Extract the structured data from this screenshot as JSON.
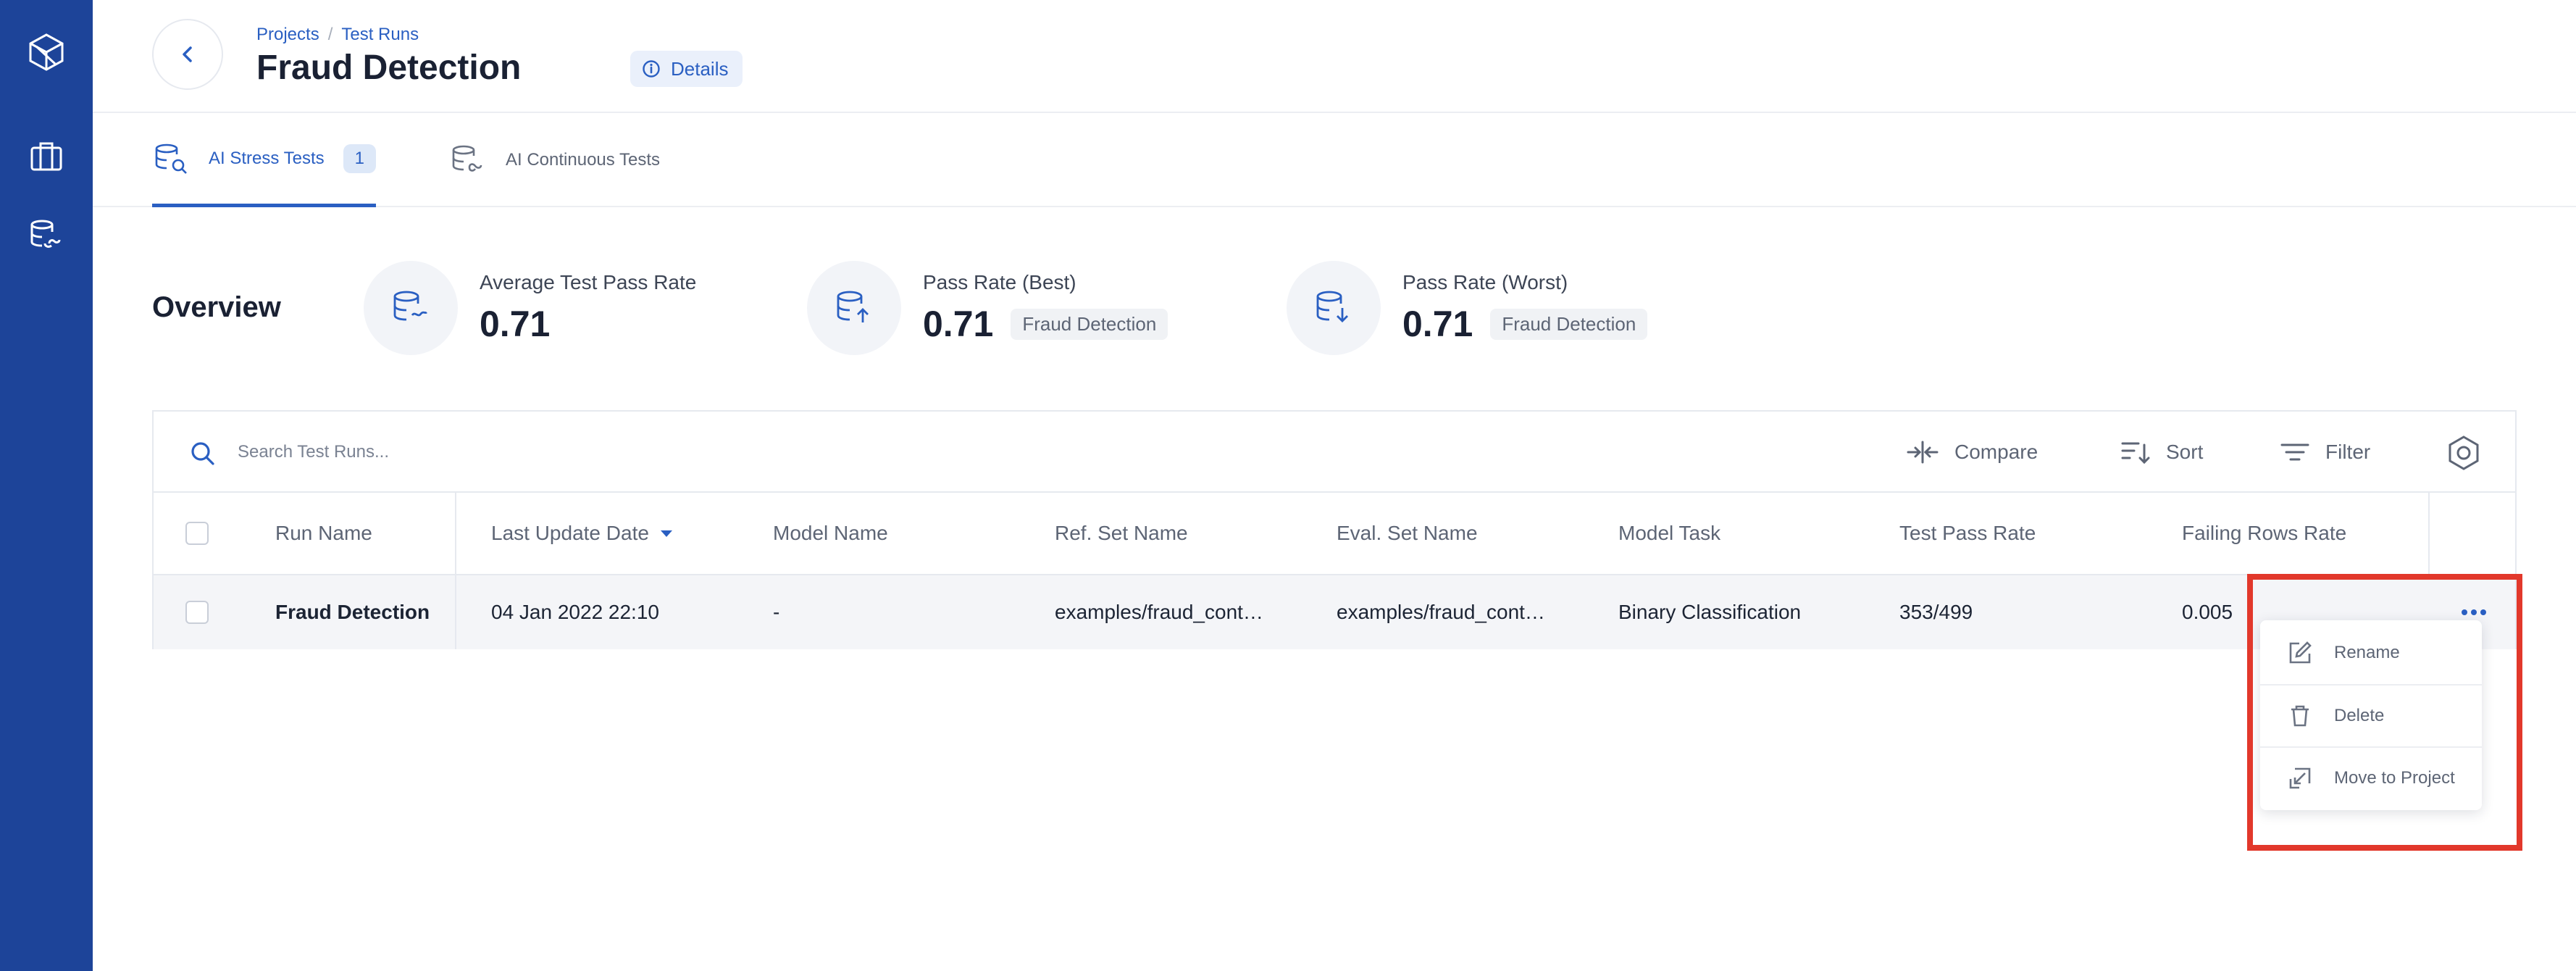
{
  "sidebar": {
    "items": [
      {
        "icon": "logo-icon"
      },
      {
        "icon": "briefcase-icon"
      },
      {
        "icon": "database-continuous-icon"
      }
    ]
  },
  "header": {
    "breadcrumb": [
      "Projects",
      "Test Runs"
    ],
    "breadcrumb_sep": "/",
    "title": "Fraud Detection",
    "details_label": "Details"
  },
  "tabs": [
    {
      "label": "AI Stress Tests",
      "count": "1",
      "active": true
    },
    {
      "label": "AI Continuous Tests",
      "active": false
    }
  ],
  "overview": {
    "title": "Overview",
    "metrics": [
      {
        "label": "Average Test Pass Rate",
        "value": "0.71"
      },
      {
        "label": "Pass Rate (Best)",
        "value": "0.71",
        "tag": "Fraud Detection"
      },
      {
        "label": "Pass Rate (Worst)",
        "value": "0.71",
        "tag": "Fraud Detection"
      }
    ]
  },
  "toolbar": {
    "search_placeholder": "Search Test Runs...",
    "compare_label": "Compare",
    "sort_label": "Sort",
    "filter_label": "Filter"
  },
  "table": {
    "columns": [
      "Run Name",
      "Last Update Date",
      "Model Name",
      "Ref. Set Name",
      "Eval. Set Name",
      "Model Task",
      "Test Pass Rate",
      "Failing Rows Rate"
    ],
    "rows": [
      [
        "Fraud Detection",
        "04 Jan 2022 22:10",
        "-",
        "examples/fraud_cont…",
        "examples/fraud_cont…",
        "Binary Classification",
        "353/499",
        "0.005"
      ]
    ]
  },
  "menu": {
    "items": [
      "Rename",
      "Delete",
      "Move to Project"
    ]
  },
  "colors": {
    "sidebar": "#1d4499",
    "accent": "#2a5fc2",
    "highlight": "#e2382b"
  }
}
